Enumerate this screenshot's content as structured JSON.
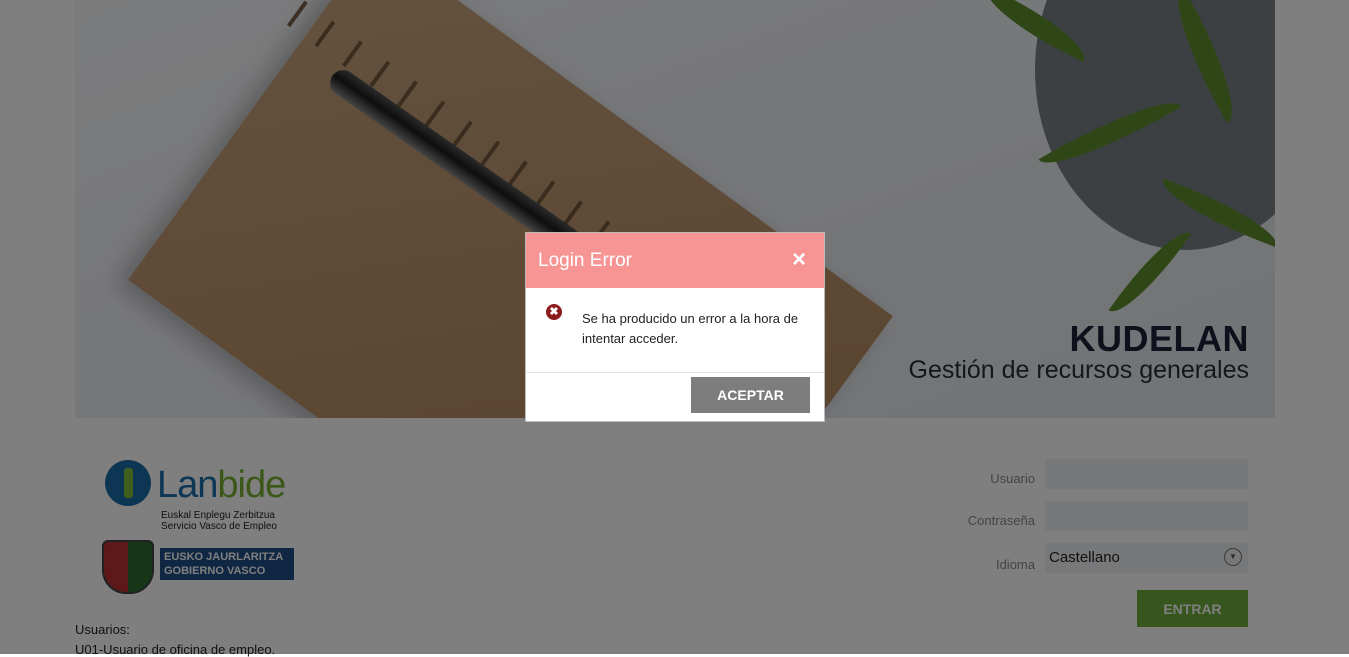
{
  "hero": {
    "title": "KUDELAN",
    "subtitle": "Gestión de recursos generales"
  },
  "logos": {
    "lanbide_name_a": "Lan",
    "lanbide_name_b": "bide",
    "lanbide_sub_1": "Euskal Enplegu Zerbitzua",
    "lanbide_sub_2": "Servicio Vasco de Empleo",
    "gv_line_1": "EUSKO JAURLARITZA",
    "gv_line_2": "GOBIERNO VASCO"
  },
  "users": {
    "title": "Usuarios:",
    "line_1": "U01-Usuario de oficina de empleo."
  },
  "form": {
    "usuario_label": "Usuario",
    "usuario_value": "",
    "contrasena_label": "Contraseña",
    "contrasena_value": "",
    "idioma_label": "Idioma",
    "idioma_value": "Castellano",
    "submit_label": "ENTRAR"
  },
  "modal": {
    "title": "Login Error",
    "close_glyph": "×",
    "error_glyph": "✖",
    "message": "Se ha producido un error a la hora de intentar acceder.",
    "accept_label": "ACEPTAR",
    "header_color": "#f79595"
  },
  "colors": {
    "entrar_button": "#6fad3a",
    "aceptar_button": "#7d7d7d",
    "error_icon": "#8c1c1c"
  }
}
